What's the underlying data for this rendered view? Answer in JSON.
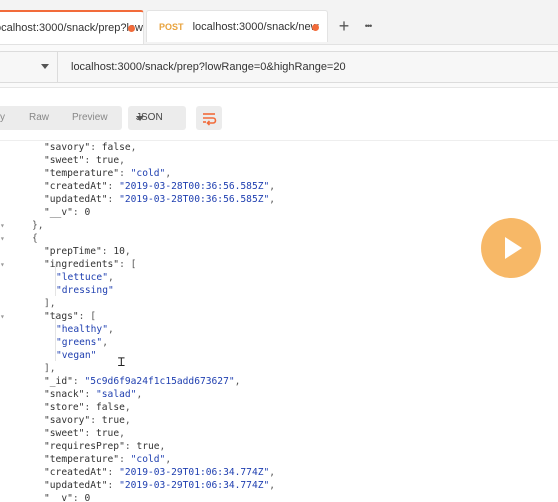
{
  "tabs": [
    {
      "method": "",
      "label": "ocalhost:3000/snack/prep?lowR.",
      "active": true
    },
    {
      "method": "POST",
      "label": "localhost:3000/snack/new",
      "active": false
    }
  ],
  "tab_actions": {
    "add": "+",
    "more": "•••"
  },
  "request": {
    "url": "localhost:3000/snack/prep?lowRange=0&highRange=20"
  },
  "response_toolbar": {
    "views": [
      "y",
      "Raw",
      "Preview"
    ],
    "format": "JSON"
  },
  "colors": {
    "accent": "#f26b3a",
    "post_method": "#e8a33d",
    "string": "#1f3fb0",
    "play_overlay": "#f7b35b"
  },
  "icons": {
    "wrap": "wrap-lines-icon",
    "play": "play-icon",
    "caret": "chevron-down-icon"
  },
  "code_lines": [
    {
      "indent": 3,
      "parts": [
        [
          "k",
          "\"savory\""
        ],
        [
          "p",
          ": "
        ],
        [
          "b",
          "false"
        ],
        [
          "p",
          ","
        ]
      ]
    },
    {
      "indent": 3,
      "parts": [
        [
          "k",
          "\"sweet\""
        ],
        [
          "p",
          ": "
        ],
        [
          "b",
          "true"
        ],
        [
          "p",
          ","
        ]
      ]
    },
    {
      "indent": 3,
      "parts": [
        [
          "k",
          "\"temperature\""
        ],
        [
          "p",
          ": "
        ],
        [
          "s",
          "\"cold\""
        ],
        [
          "p",
          ","
        ]
      ]
    },
    {
      "indent": 3,
      "parts": [
        [
          "k",
          "\"createdAt\""
        ],
        [
          "p",
          ": "
        ],
        [
          "s",
          "\"2019-03-28T00:36:56.585Z\""
        ],
        [
          "p",
          ","
        ]
      ]
    },
    {
      "indent": 3,
      "parts": [
        [
          "k",
          "\"updatedAt\""
        ],
        [
          "p",
          ": "
        ],
        [
          "s",
          "\"2019-03-28T00:36:56.585Z\""
        ],
        [
          "p",
          ","
        ]
      ]
    },
    {
      "indent": 3,
      "parts": [
        [
          "k",
          "\"__v\""
        ],
        [
          "p",
          ": "
        ],
        [
          "n",
          "0"
        ]
      ]
    },
    {
      "indent": 2,
      "parts": [
        [
          "p",
          "},"
        ]
      ]
    },
    {
      "indent": 2,
      "parts": [
        [
          "p",
          "{"
        ]
      ]
    },
    {
      "indent": 3,
      "parts": [
        [
          "k",
          "\"prepTime\""
        ],
        [
          "p",
          ": "
        ],
        [
          "n",
          "10"
        ],
        [
          "p",
          ","
        ]
      ]
    },
    {
      "indent": 3,
      "parts": [
        [
          "k",
          "\"ingredients\""
        ],
        [
          "p",
          ": ["
        ]
      ]
    },
    {
      "indent": 4,
      "parts": [
        [
          "s",
          "\"lettuce\""
        ],
        [
          "p",
          ","
        ]
      ]
    },
    {
      "indent": 4,
      "parts": [
        [
          "s",
          "\"dressing\""
        ]
      ]
    },
    {
      "indent": 3,
      "parts": [
        [
          "p",
          "],"
        ]
      ]
    },
    {
      "indent": 3,
      "parts": [
        [
          "k",
          "\"tags\""
        ],
        [
          "p",
          ": ["
        ]
      ]
    },
    {
      "indent": 4,
      "parts": [
        [
          "s",
          "\"healthy\""
        ],
        [
          "p",
          ","
        ]
      ]
    },
    {
      "indent": 4,
      "parts": [
        [
          "s",
          "\"greens\""
        ],
        [
          "p",
          ","
        ]
      ]
    },
    {
      "indent": 4,
      "parts": [
        [
          "s",
          "\"vegan\""
        ]
      ]
    },
    {
      "indent": 3,
      "parts": [
        [
          "p",
          "],"
        ]
      ]
    },
    {
      "indent": 3,
      "parts": [
        [
          "k",
          "\"_id\""
        ],
        [
          "p",
          ": "
        ],
        [
          "s",
          "\"5c9d6f9a24f1c15add673627\""
        ],
        [
          "p",
          ","
        ]
      ]
    },
    {
      "indent": 3,
      "parts": [
        [
          "k",
          "\"snack\""
        ],
        [
          "p",
          ": "
        ],
        [
          "s",
          "\"salad\""
        ],
        [
          "p",
          ","
        ]
      ]
    },
    {
      "indent": 3,
      "parts": [
        [
          "k",
          "\"store\""
        ],
        [
          "p",
          ": "
        ],
        [
          "b",
          "false"
        ],
        [
          "p",
          ","
        ]
      ]
    },
    {
      "indent": 3,
      "parts": [
        [
          "k",
          "\"savory\""
        ],
        [
          "p",
          ": "
        ],
        [
          "b",
          "true"
        ],
        [
          "p",
          ","
        ]
      ]
    },
    {
      "indent": 3,
      "parts": [
        [
          "k",
          "\"sweet\""
        ],
        [
          "p",
          ": "
        ],
        [
          "b",
          "true"
        ],
        [
          "p",
          ","
        ]
      ]
    },
    {
      "indent": 3,
      "parts": [
        [
          "k",
          "\"requiresPrep\""
        ],
        [
          "p",
          ": "
        ],
        [
          "b",
          "true"
        ],
        [
          "p",
          ","
        ]
      ]
    },
    {
      "indent": 3,
      "parts": [
        [
          "k",
          "\"temperature\""
        ],
        [
          "p",
          ": "
        ],
        [
          "s",
          "\"cold\""
        ],
        [
          "p",
          ","
        ]
      ]
    },
    {
      "indent": 3,
      "parts": [
        [
          "k",
          "\"createdAt\""
        ],
        [
          "p",
          ": "
        ],
        [
          "s",
          "\"2019-03-29T01:06:34.774Z\""
        ],
        [
          "p",
          ","
        ]
      ]
    },
    {
      "indent": 3,
      "parts": [
        [
          "k",
          "\"updatedAt\""
        ],
        [
          "p",
          ": "
        ],
        [
          "s",
          "\"2019-03-29T01:06:34.774Z\""
        ],
        [
          "p",
          ","
        ]
      ]
    },
    {
      "indent": 3,
      "parts": [
        [
          "k",
          "\"__v\""
        ],
        [
          "p",
          ": "
        ],
        [
          "n",
          "0"
        ]
      ]
    }
  ]
}
